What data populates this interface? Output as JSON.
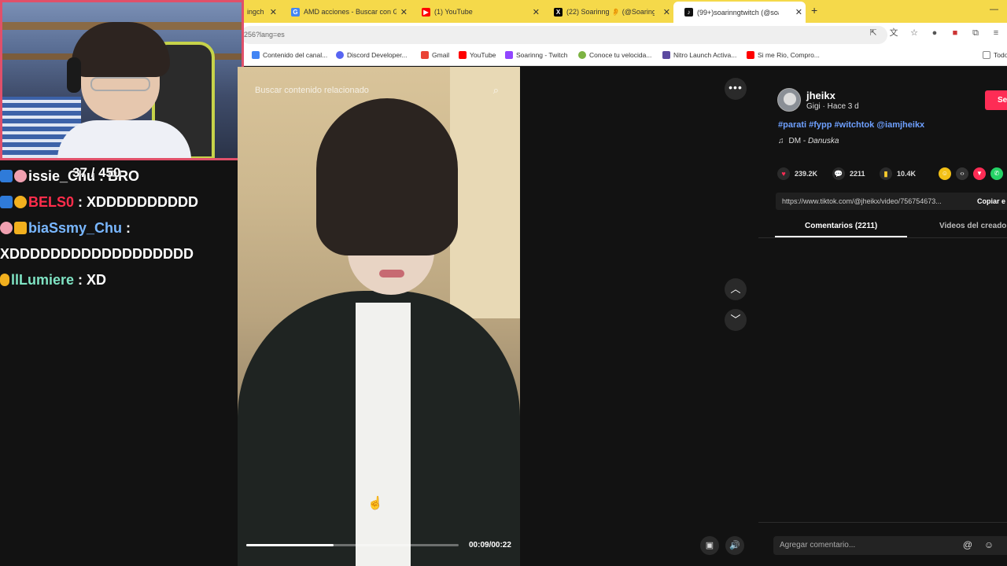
{
  "browser": {
    "tabs": [
      {
        "label": "ingch",
        "fav_color": "#9146ff",
        "fav_glyph": "t"
      },
      {
        "label": "AMD acciones - Buscar con Go",
        "fav_color": "#4285f4",
        "fav_glyph": "G"
      },
      {
        "label": "(1) YouTube",
        "fav_color": "#ff0000",
        "fav_glyph": "▶"
      },
      {
        "label": "(22) Soarinng 👂 (@Soaringch",
        "fav_color": "#000000",
        "fav_glyph": "X"
      },
      {
        "label": "(99+)soarinngtwitch (@soa",
        "fav_color": "#111111",
        "fav_glyph": "♪"
      }
    ],
    "url": "256?lang=es",
    "bookmarks": [
      {
        "label": "Contenido del canal...",
        "color": "#4285f4"
      },
      {
        "label": "Discord Developer...",
        "color": "#5865f2"
      },
      {
        "label": "Gmail",
        "color": "#ea4335"
      },
      {
        "label": "YouTube",
        "color": "#ff0000"
      },
      {
        "label": "Soarinng - Twitch",
        "color": "#9146ff"
      },
      {
        "label": "Conoce tu velocida...",
        "color": "#7cb342"
      },
      {
        "label": "Nitro Launch Activa...",
        "color": "#5c4aa0"
      },
      {
        "label": "Si me Rio, Compro...",
        "color": "#ff0000"
      },
      {
        "label": "Todo",
        "color": "#888888"
      }
    ]
  },
  "stream": {
    "counter": "37 / 450",
    "chat": [
      {
        "user": "issie_Chu",
        "user_color": "#ffffff",
        "text": " : BRO"
      },
      {
        "user": "BELS0",
        "user_color": "#ff2d4b",
        "text": " : XDDDDDDDDDD"
      },
      {
        "user": "biaSsmy_Chu",
        "user_color": "#79b7ff",
        "text": " :"
      },
      {
        "user": "",
        "user_color": "#ffffff",
        "text": "XDDDDDDDDDDDDDDDDDD"
      },
      {
        "user": "llLumiere",
        "user_color": "#7fe3c3",
        "text": " : XD"
      }
    ]
  },
  "video": {
    "search_placeholder": "Buscar contenido relacionado",
    "time": "00:09/00:22",
    "progress": 0.41
  },
  "post": {
    "username": "jheikx",
    "subline": "Gigi · Hace 3 d",
    "follow_label": "Se",
    "caption": "#parati #fypp #witchtok @iamjheikx",
    "music_artist": "DM - ",
    "music_song": "Danuska",
    "likes": "239.2K",
    "comments": "2211",
    "saves": "10.4K",
    "link": "https://www.tiktok.com/@jheikx/video/756754673...",
    "copy_label": "Copiar e",
    "tab_comments": "Comentarios (2211)",
    "tab_videos": "Videos del creador",
    "comment_placeholder": "Agregar comentario..."
  },
  "colors": {
    "accent": "#fe2c55",
    "hashtag": "#6ea0ff",
    "tabbar": "#f5d94a"
  }
}
